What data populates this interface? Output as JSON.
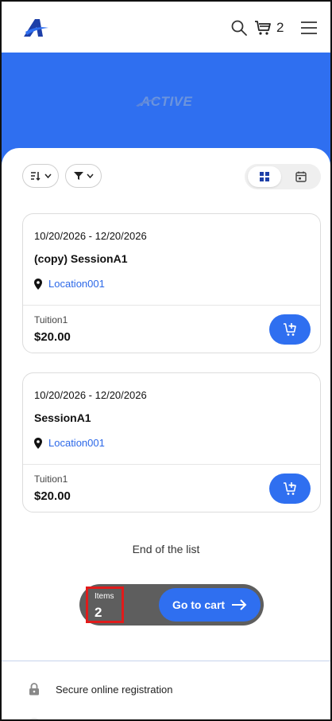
{
  "header": {
    "logo_icon": "active-a-logo-icon",
    "search_icon": "search-icon",
    "cart_icon": "cart-icon",
    "cart_count": "2",
    "menu_icon": "menu-icon"
  },
  "banner": {
    "brand": "ACTIVE",
    "color": "#2f6ff0"
  },
  "toolbar": {
    "sort_icon": "sort-icon",
    "filter_icon": "filter-icon",
    "grid_view_icon": "grid-view-icon",
    "calendar_view_icon": "calendar-view-icon"
  },
  "sessions": [
    {
      "dates": "10/20/2026 - 12/20/2026",
      "title": "(copy) SessionA1",
      "location": "Location001",
      "fee_name": "Tuition1",
      "price": "$20.00"
    },
    {
      "dates": "10/20/2026 - 12/20/2026",
      "title": "SessionA1",
      "location": "Location001",
      "fee_name": "Tuition1",
      "price": "$20.00"
    }
  ],
  "list_end": "End of the list",
  "cart_bar": {
    "items_label": "Items",
    "items_count": "2",
    "button_label": "Go to cart"
  },
  "footer": {
    "secure_text": "Secure online registration",
    "lock_icon": "lock-icon"
  },
  "colors": {
    "accent": "#2f6ff0",
    "link": "#2c68e8",
    "highlight": "#e11b1b"
  }
}
